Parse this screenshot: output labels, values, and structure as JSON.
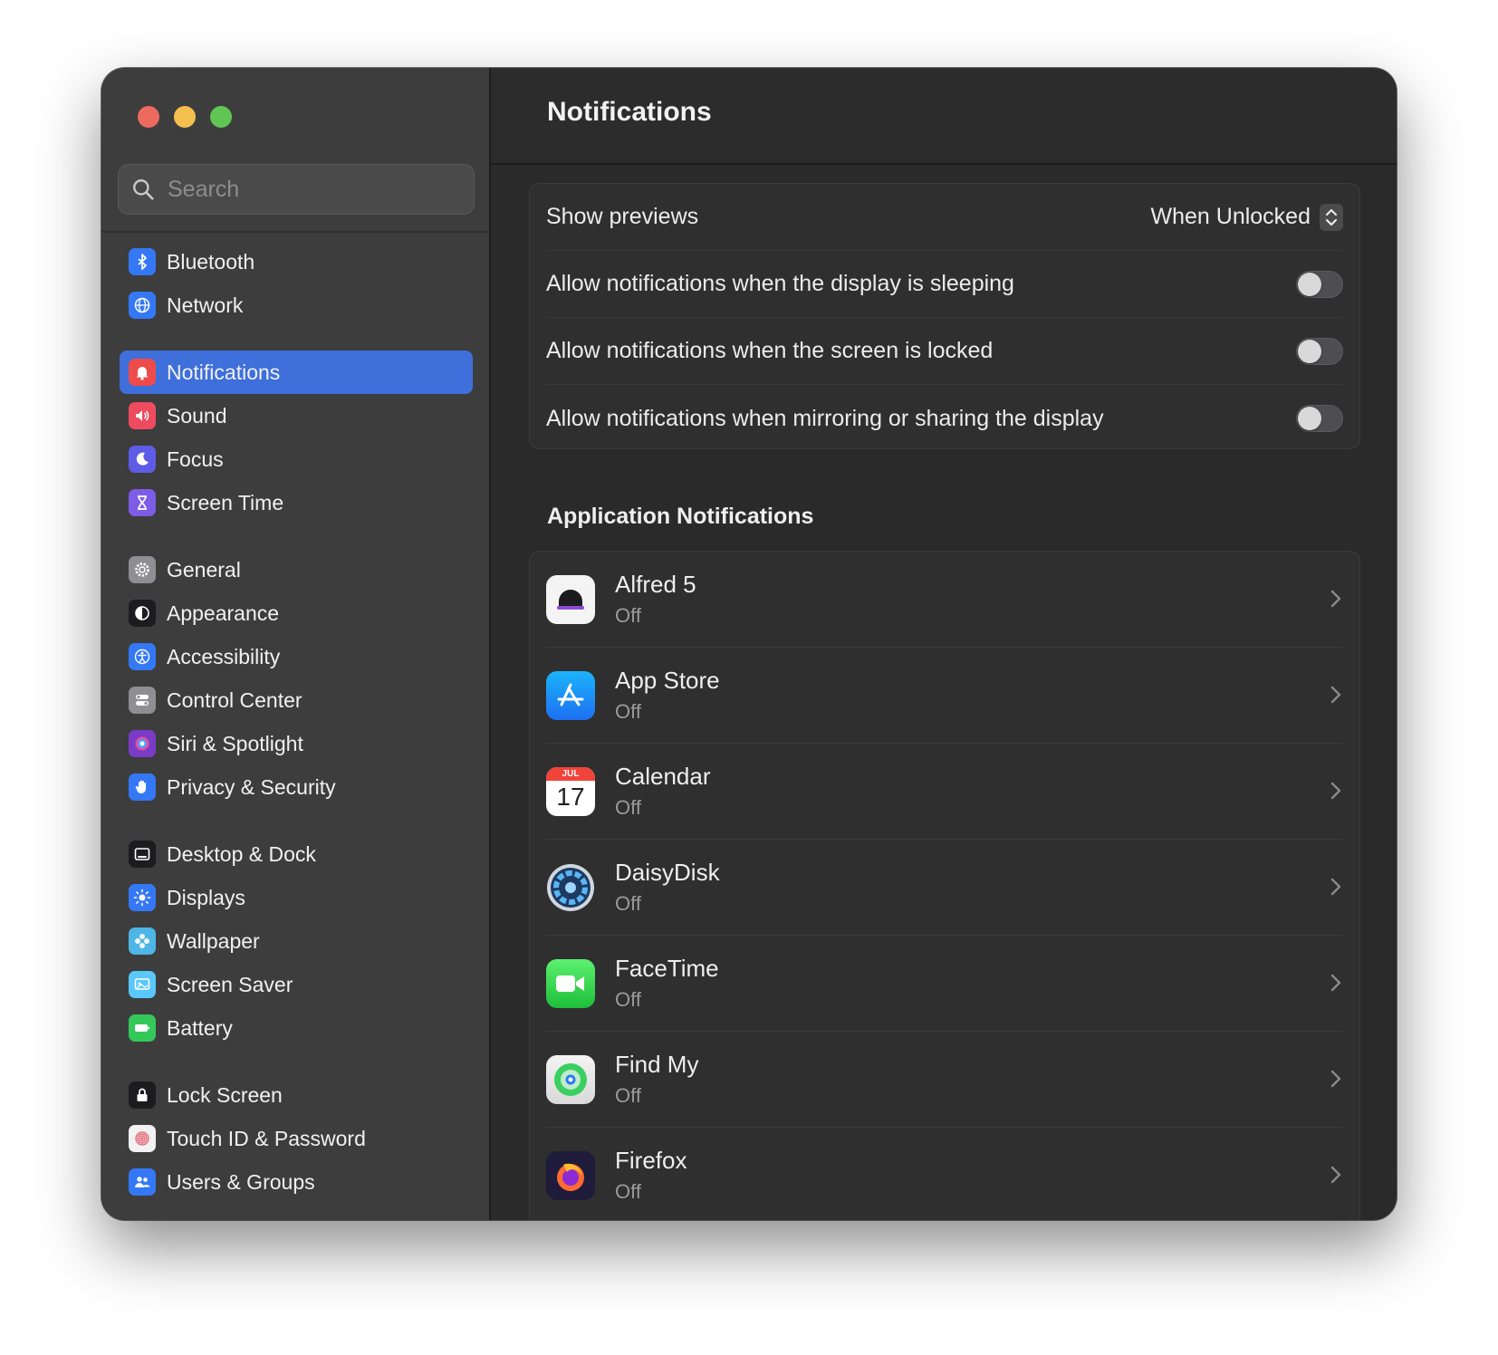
{
  "sidebar": {
    "search_placeholder": "Search",
    "groups": [
      [
        {
          "label": "Bluetooth",
          "icon": "bluetooth-icon",
          "color": "#3478f6"
        },
        {
          "label": "Network",
          "icon": "globe-icon",
          "color": "#3478f6"
        }
      ],
      [
        {
          "label": "Notifications",
          "icon": "bell-icon",
          "color": "#ee4b4b",
          "active": true
        },
        {
          "label": "Sound",
          "icon": "speaker-icon",
          "color": "#ee4b5e"
        },
        {
          "label": "Focus",
          "icon": "moon-icon",
          "color": "#5e5ce6"
        },
        {
          "label": "Screen Time",
          "icon": "hourglass-icon",
          "color": "#7d5ce6"
        }
      ],
      [
        {
          "label": "General",
          "icon": "gear-icon",
          "color": "#8e8e93"
        },
        {
          "label": "Appearance",
          "icon": "appearance-icon",
          "color": "#1c1c1e"
        },
        {
          "label": "Accessibility",
          "icon": "accessibility-icon",
          "color": "#3478f6"
        },
        {
          "label": "Control Center",
          "icon": "control-center-icon",
          "color": "#8e8e93"
        },
        {
          "label": "Siri & Spotlight",
          "icon": "siri-icon",
          "color": "#7a3cc7"
        },
        {
          "label": "Privacy & Security",
          "icon": "hand-icon",
          "color": "#3478f6"
        }
      ],
      [
        {
          "label": "Desktop & Dock",
          "icon": "dock-icon",
          "color": "#1c1c1e"
        },
        {
          "label": "Displays",
          "icon": "sun-icon",
          "color": "#3478f6"
        },
        {
          "label": "Wallpaper",
          "icon": "flower-icon",
          "color": "#4db6e6"
        },
        {
          "label": "Screen Saver",
          "icon": "screen-saver-icon",
          "color": "#5ac8fa"
        },
        {
          "label": "Battery",
          "icon": "battery-icon",
          "color": "#34c759"
        }
      ],
      [
        {
          "label": "Lock Screen",
          "icon": "lock-icon",
          "color": "#1c1c1e"
        },
        {
          "label": "Touch ID & Password",
          "icon": "fingerprint-icon",
          "color": "#f2f2f2"
        },
        {
          "label": "Users & Groups",
          "icon": "users-icon",
          "color": "#3478f6"
        }
      ]
    ]
  },
  "main": {
    "title": "Notifications",
    "show_previews_label": "Show previews",
    "show_previews_value": "When Unlocked",
    "toggles": [
      {
        "label": "Allow notifications when the display is sleeping",
        "on": false
      },
      {
        "label": "Allow notifications when the screen is locked",
        "on": false
      },
      {
        "label": "Allow notifications when mirroring or sharing the display",
        "on": false
      }
    ],
    "apps_section_title": "Application Notifications",
    "apps": [
      {
        "name": "Alfred 5",
        "status": "Off",
        "icon": "alfred-icon"
      },
      {
        "name": "App Store",
        "status": "Off",
        "icon": "app-store-icon"
      },
      {
        "name": "Calendar",
        "status": "Off",
        "icon": "calendar-icon",
        "month": "JUL",
        "day": "17"
      },
      {
        "name": "DaisyDisk",
        "status": "Off",
        "icon": "daisydisk-icon"
      },
      {
        "name": "FaceTime",
        "status": "Off",
        "icon": "facetime-icon"
      },
      {
        "name": "Find My",
        "status": "Off",
        "icon": "find-my-icon"
      },
      {
        "name": "Firefox",
        "status": "Off",
        "icon": "firefox-icon"
      }
    ]
  },
  "colors": {
    "accent": "#3f6fdb",
    "traffic_red": "#ed6a5e",
    "traffic_yellow": "#f5bf4f",
    "traffic_green": "#61c554"
  }
}
